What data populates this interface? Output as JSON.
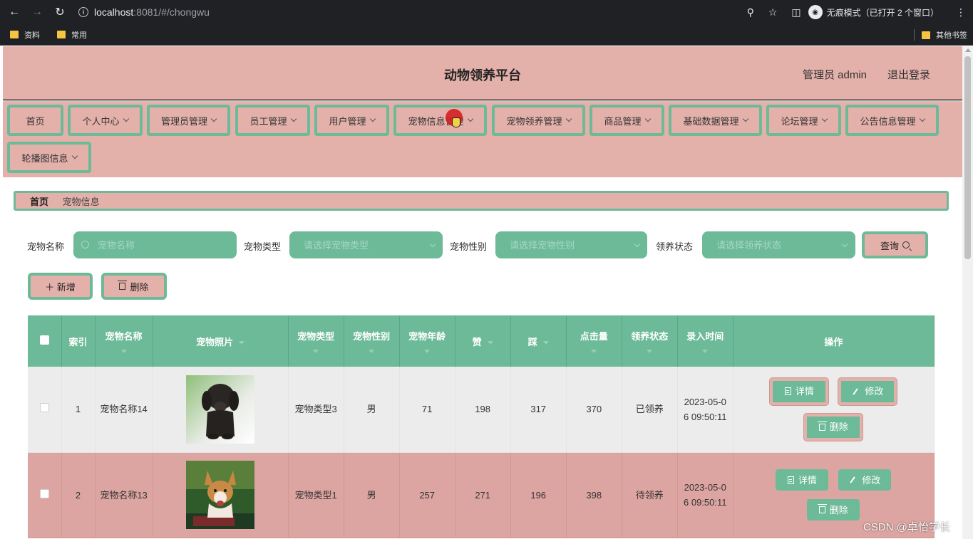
{
  "browser": {
    "url_host": "localhost",
    "url_path": ":8081/#/chongwu",
    "incognito_label": "无痕模式（已打开 2 个窗口）",
    "bookmarks": [
      "资料",
      "常用"
    ],
    "other_bookmarks": "其他书签"
  },
  "header": {
    "title": "动物领养平台",
    "admin": "管理员 admin",
    "logout": "退出登录"
  },
  "menu": {
    "items": [
      {
        "label": "首页"
      },
      {
        "label": "个人中心"
      },
      {
        "label": "管理员管理"
      },
      {
        "label": "员工管理"
      },
      {
        "label": "用户管理"
      },
      {
        "label": "宠物信息管理"
      },
      {
        "label": "宠物领养管理"
      },
      {
        "label": "商品管理"
      },
      {
        "label": "基础数据管理"
      },
      {
        "label": "论坛管理"
      },
      {
        "label": "公告信息管理"
      },
      {
        "label": "轮播图信息"
      }
    ]
  },
  "breadcrumb": {
    "home": "首页",
    "separator": "/",
    "current": "宠物信息"
  },
  "search": {
    "name_label": "宠物名称",
    "name_placeholder": "宠物名称",
    "type_label": "宠物类型",
    "type_placeholder": "请选择宠物类型",
    "sex_label": "宠物性别",
    "sex_placeholder": "请选择宠物性别",
    "status_label": "领养状态",
    "status_placeholder": "请选择领养状态",
    "query_button": "查询"
  },
  "actions": {
    "add": "＋ 新增",
    "delete": "删除"
  },
  "table": {
    "headers": {
      "index": "索引",
      "name": "宠物名称",
      "photo": "宠物照片",
      "type": "宠物类型",
      "sex": "宠物性别",
      "age": "宠物年龄",
      "zan": "赞",
      "cai": "踩",
      "clicks": "点击量",
      "status": "领养状态",
      "time": "录入时间",
      "ops": "操作"
    },
    "rows": [
      {
        "index": "1",
        "name": "宠物名称14",
        "type": "宠物类型3",
        "sex": "男",
        "age": "71",
        "zan": "198",
        "cai": "317",
        "clicks": "370",
        "status": "已领养",
        "time": "2023-05-06 09:50:11",
        "photo": "black-puppy"
      },
      {
        "index": "2",
        "name": "宠物名称13",
        "type": "宠物类型1",
        "sex": "男",
        "age": "257",
        "zan": "271",
        "cai": "196",
        "clicks": "398",
        "status": "待领养",
        "time": "2023-05-06 09:50:11",
        "photo": "corgi"
      }
    ],
    "row_buttons": {
      "detail": "详情",
      "edit": "修改",
      "delete": "删除"
    }
  },
  "watermark": "CSDN @卓怡学长",
  "colors": {
    "green": "#6dba98",
    "pink": "#e3b0aa",
    "row_pink": "#dda5a1",
    "row_grey": "#ececec"
  }
}
